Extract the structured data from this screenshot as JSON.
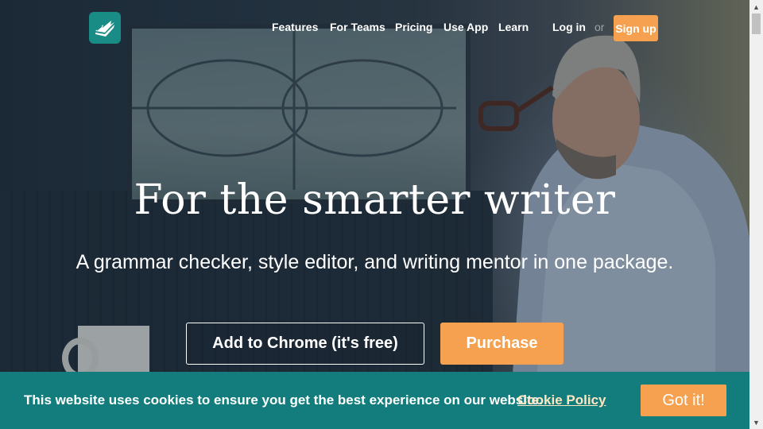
{
  "header": {
    "nav": [
      {
        "label": "Features"
      },
      {
        "label": "For Teams"
      },
      {
        "label": "Pricing"
      },
      {
        "label": "Use App"
      },
      {
        "label": "Learn"
      }
    ],
    "login_label": "Log in",
    "or_label": "or",
    "signup_label": "Sign up"
  },
  "hero": {
    "headline": "For the smarter writer",
    "subhead": "A grammar checker, style editor, and writing mentor in one package.",
    "primary_cta": "Add to Chrome (it's free)",
    "secondary_cta": "Purchase"
  },
  "cookie_banner": {
    "message": "This website uses cookies to ensure you get the best experience on our website.",
    "policy_link": "Cookie Policy",
    "accept_label": "Got it!"
  },
  "colors": {
    "brand_teal": "#1a8c86",
    "cookie_teal": "#137c7c",
    "accent_orange": "#f5a14f"
  },
  "icons": {
    "logo": "feather-pages-icon",
    "scroll_up": "scroll-up-arrow-icon",
    "scroll_down": "scroll-down-arrow-icon"
  }
}
